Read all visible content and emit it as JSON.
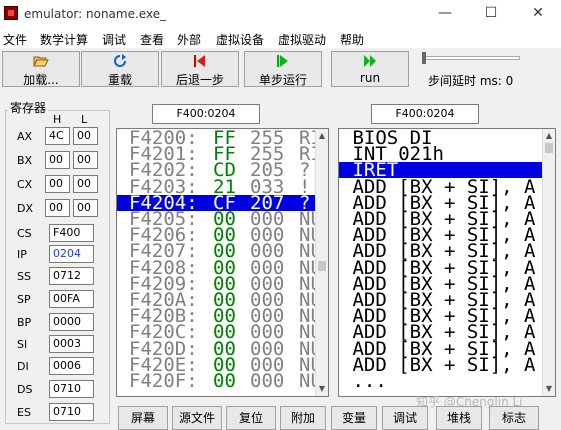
{
  "window": {
    "title": "emulator: noname.exe_",
    "minimize": "—",
    "maximize": "☐",
    "close": "✕"
  },
  "menu": [
    "文件",
    "数学计算",
    "调试",
    "查看",
    "外部",
    "虚拟设备",
    "虚拟驱动",
    "帮助"
  ],
  "toolbar": {
    "load": "加载...",
    "reload": "重载",
    "step_back": "后退一步",
    "single_step": "单步运行",
    "run": "run",
    "delay_label": "步间延时 ms: 0",
    "delay_ms": 0
  },
  "registers": {
    "title": "寄存器",
    "h": "H",
    "l": "L",
    "ax_name": "AX",
    "ax_h": "4C",
    "ax_l": "00",
    "bx_name": "BX",
    "bx_h": "00",
    "bx_l": "00",
    "cx_name": "CX",
    "cx_h": "00",
    "cx_l": "00",
    "dx_name": "DX",
    "dx_h": "00",
    "dx_l": "00",
    "cs_name": "CS",
    "cs": "F400",
    "ip_name": "IP",
    "ip": "0204",
    "ss_name": "SS",
    "ss": "0712",
    "sp_name": "SP",
    "sp": "00FA",
    "bp_name": "BP",
    "bp": "0000",
    "si_name": "SI",
    "si": "0003",
    "di_name": "DI",
    "di": "0006",
    "ds_name": "DS",
    "ds": "0710",
    "es_name": "ES",
    "es": "0710",
    "colors": {
      "ip_value": "#1f3fbf"
    }
  },
  "memory_address": "F400:0204",
  "disasm_address": "F400:0204",
  "memory_rows": [
    {
      "addr": "F4200:",
      "hex": "FF",
      "dec": "255",
      "chr": "RI"
    },
    {
      "addr": "F4201:",
      "hex": "FF",
      "dec": "255",
      "chr": "RI"
    },
    {
      "addr": "F4202:",
      "hex": "CD",
      "dec": "205",
      "chr": "?"
    },
    {
      "addr": "F4203:",
      "hex": "21",
      "dec": "033",
      "chr": "!"
    },
    {
      "addr": "F4204:",
      "hex": "CF",
      "dec": "207",
      "chr": "?"
    },
    {
      "addr": "F4205:",
      "hex": "00",
      "dec": "000",
      "chr": "NU"
    },
    {
      "addr": "F4206:",
      "hex": "00",
      "dec": "000",
      "chr": "NU"
    },
    {
      "addr": "F4207:",
      "hex": "00",
      "dec": "000",
      "chr": "NU"
    },
    {
      "addr": "F4208:",
      "hex": "00",
      "dec": "000",
      "chr": "NU"
    },
    {
      "addr": "F4209:",
      "hex": "00",
      "dec": "000",
      "chr": "NU"
    },
    {
      "addr": "F420A:",
      "hex": "00",
      "dec": "000",
      "chr": "NU"
    },
    {
      "addr": "F420B:",
      "hex": "00",
      "dec": "000",
      "chr": "NU"
    },
    {
      "addr": "F420C:",
      "hex": "00",
      "dec": "000",
      "chr": "NU"
    },
    {
      "addr": "F420D:",
      "hex": "00",
      "dec": "000",
      "chr": "NU"
    },
    {
      "addr": "F420E:",
      "hex": "00",
      "dec": "000",
      "chr": "NU"
    },
    {
      "addr": "F420F:",
      "hex": "00",
      "dec": "000",
      "chr": "NU"
    }
  ],
  "disasm_rows": [
    " BIOS DI",
    " INT 021h",
    " IRET",
    " ADD [BX + SI], A",
    " ADD [BX + SI], A",
    " ADD [BX + SI], A",
    " ADD [BX + SI], A",
    " ADD [BX + SI], A",
    " ADD [BX + SI], A",
    " ADD [BX + SI], A",
    " ADD [BX + SI], A",
    " ADD [BX + SI], A",
    " ADD [BX + SI], A",
    " ADD [BX + SI], A",
    " ADD [BX + SI], A",
    " ..."
  ],
  "selected_memory_row": 4,
  "selected_disasm_row": 2,
  "colors": {
    "selection": "#0000e0",
    "hex": "#008000",
    "dim": "#808080"
  },
  "tabs": [
    "屏幕",
    "源文件",
    "复位",
    "附加",
    "变量",
    "调试",
    "堆栈",
    "标志"
  ],
  "watermark": "知乎 @Chenglin Li"
}
